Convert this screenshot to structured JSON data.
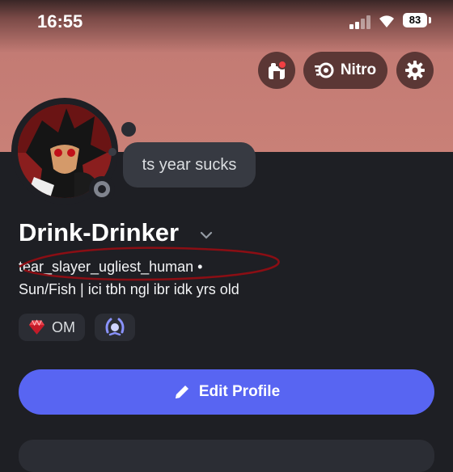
{
  "status_bar": {
    "time": "16:55",
    "battery": "83"
  },
  "header": {
    "nitro_label": "Nitro",
    "icons": [
      "shop-icon",
      "nitro-icon",
      "gear-icon"
    ]
  },
  "profile": {
    "status_text": "ts year sucks",
    "display_name": "Drink-Drinker",
    "username": "tear_slayer_ugliest_human •",
    "pronouns": "Sun/Fish | ici tbh ngl ibr idk yrs old",
    "badges": [
      {
        "label": "OM",
        "icon": "gem-icon"
      },
      {
        "label": "",
        "icon": "laurel-badge-icon"
      }
    ]
  },
  "actions": {
    "edit_profile_label": "Edit Profile"
  },
  "colors": {
    "banner": "#c98077",
    "accent": "#5865f2",
    "background": "#1e1f24"
  }
}
